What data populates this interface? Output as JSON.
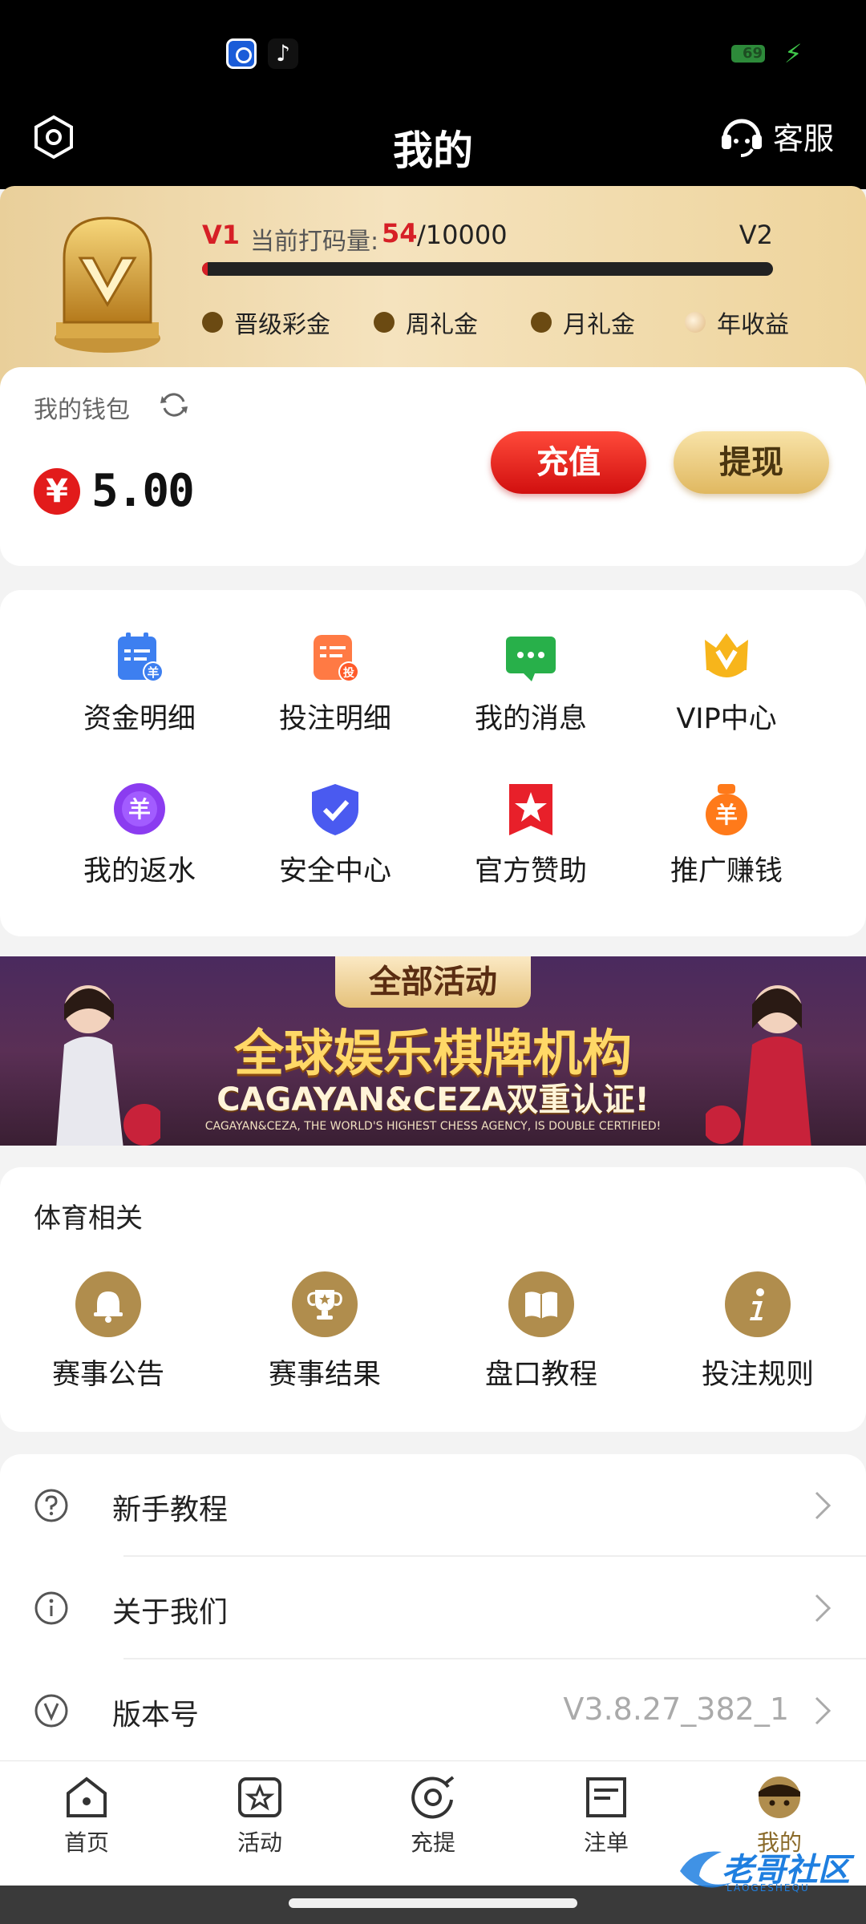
{
  "header": {
    "title": "我的",
    "service_label": "客服"
  },
  "vip": {
    "current_level": "V1",
    "code_label": "当前打码量:",
    "code_current": "54",
    "code_total": "/10000",
    "next_level": "V2",
    "progress": 0.0054,
    "perks": [
      "晋级彩金",
      "周礼金",
      "月礼金",
      "年收益"
    ]
  },
  "wallet": {
    "label": "我的钱包",
    "currency": "¥",
    "balance": "5.00",
    "deposit_label": "充值",
    "withdraw_label": "提现"
  },
  "quick_links": [
    {
      "label": "资金明细",
      "icon": "fund-detail-icon"
    },
    {
      "label": "投注明细",
      "icon": "bet-detail-icon"
    },
    {
      "label": "我的消息",
      "icon": "message-icon"
    },
    {
      "label": "VIP中心",
      "icon": "vip-crown-icon"
    },
    {
      "label": "我的返水",
      "icon": "rebate-icon"
    },
    {
      "label": "安全中心",
      "icon": "shield-check-icon"
    },
    {
      "label": "官方赞助",
      "icon": "star-flag-icon"
    },
    {
      "label": "推广赚钱",
      "icon": "money-bag-icon"
    }
  ],
  "quick_icon_glyphs": {
    "fund": "羊",
    "bet": "投",
    "rebate": "羊",
    "promo": "羊"
  },
  "banner": {
    "tag": "全部活动",
    "title": "全球娱乐棋牌机构",
    "subtitle": "CAGAYAN&CEZA双重认证!",
    "small": "CAGAYAN&CEZA, THE WORLD'S HIGHEST CHESS AGENCY, IS DOUBLE CERTIFIED!"
  },
  "sports": {
    "title": "体育相关",
    "items": [
      {
        "label": "赛事公告",
        "icon": "bell-icon"
      },
      {
        "label": "赛事结果",
        "icon": "trophy-icon"
      },
      {
        "label": "盘口教程",
        "icon": "book-icon"
      },
      {
        "label": "投注规则",
        "icon": "info-icon"
      }
    ]
  },
  "menu": [
    {
      "label": "新手教程",
      "icon": "question-icon",
      "value": ""
    },
    {
      "label": "关于我们",
      "icon": "info-circle-icon",
      "value": ""
    },
    {
      "label": "版本号",
      "icon": "version-icon",
      "value": "V3.8.27_382_1"
    }
  ],
  "tabs": [
    {
      "label": "首页",
      "icon": "home-icon"
    },
    {
      "label": "活动",
      "icon": "activity-icon"
    },
    {
      "label": "充提",
      "icon": "deposit-withdraw-icon"
    },
    {
      "label": "注单",
      "icon": "bet-slip-icon"
    },
    {
      "label": "我的",
      "icon": "profile-icon",
      "active": true
    }
  ],
  "status": {
    "battery": "69"
  },
  "watermark": {
    "text": "老哥社区",
    "sub": "LAOGESHEQU"
  },
  "colors": {
    "gold": "#b08d4d",
    "red": "#d61f26",
    "header_bg": "#000000"
  }
}
